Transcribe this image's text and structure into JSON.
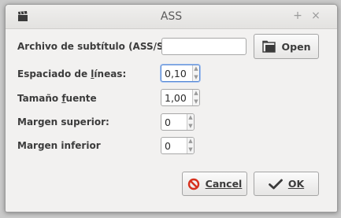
{
  "window": {
    "title": "ASS",
    "app_icon": "clapperboard-icon",
    "maximize_glyph": "+",
    "close_glyph": "×"
  },
  "form": {
    "subtitle_file_label": "Archivo de subtítulo (ASS/SSA):",
    "subtitle_file_value": "",
    "open_button_label": "Open",
    "line_spacing_label": "Espaciado de líneas:",
    "line_spacing_value": "0,10",
    "font_size_label": "Tamaño fuente",
    "font_size_value": "1,00",
    "top_margin_label": "Margen superior:",
    "top_margin_value": "0",
    "bottom_margin_label": "Margen inferior",
    "bottom_margin_value": "0"
  },
  "buttons": {
    "cancel_label": "Cancel",
    "ok_label": "OK"
  },
  "colors": {
    "cancel_icon": "#d6301d",
    "focus_ring": "#5a8bd6"
  }
}
